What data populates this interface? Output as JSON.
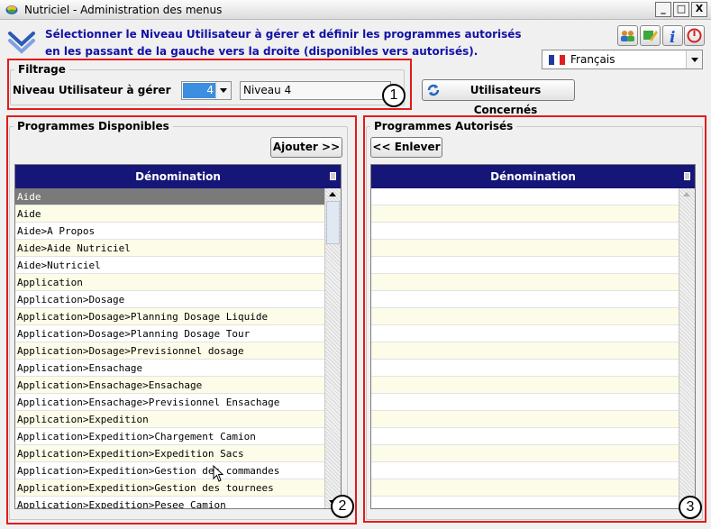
{
  "window": {
    "title": "Nutriciel - Administration des menus",
    "minimize_glyph": "_",
    "maximize_glyph": "□",
    "close_glyph": "X"
  },
  "header": {
    "instruction": "Sélectionner le Niveau Utilisateur à gérer et définir les programmes autorisés en les passant de la gauche vers la droite (disponibles vers autorisés).",
    "toolbar_icons": [
      "users-icon",
      "edit-icon",
      "info-icon",
      "power-icon"
    ],
    "language": "Français"
  },
  "filter": {
    "legend": "Filtrage",
    "level_label": "Niveau Utilisateur à gérer",
    "level_value": "4",
    "level_name": "Niveau 4",
    "concerned_users_button": "Utilisateurs Concernés"
  },
  "available": {
    "legend": "Programmes Disponibles",
    "add_button": "Ajouter >>",
    "column_header": "Dénomination",
    "rows": [
      "Aide",
      "Aide",
      "Aide>A Propos",
      "Aide>Aide Nutriciel",
      "Aide>Nutriciel",
      "Application",
      "Application>Dosage",
      "Application>Dosage>Planning Dosage Liquide",
      "Application>Dosage>Planning Dosage Tour",
      "Application>Dosage>Previsionnel dosage",
      "Application>Ensachage",
      "Application>Ensachage>Ensachage",
      "Application>Ensachage>Previsionnel Ensachage",
      "Application>Expedition",
      "Application>Expedition>Chargement Camion",
      "Application>Expedition>Expedition Sacs",
      "Application>Expedition>Gestion des commandes",
      "Application>Expedition>Gestion des tournees",
      "Application>Expedition>Pesee Camion"
    ]
  },
  "authorized": {
    "legend": "Programmes Autorisés",
    "remove_button": "<< Enlever",
    "column_header": "Dénomination",
    "rows": []
  },
  "annotations": [
    "1",
    "2",
    "3"
  ],
  "colors": {
    "grid_header": "#161679",
    "instruction_text": "#1212a6",
    "highlight_frame": "#e21b1b",
    "selected_row": "#7a7a7a",
    "alt_row": "#fcfce8"
  }
}
